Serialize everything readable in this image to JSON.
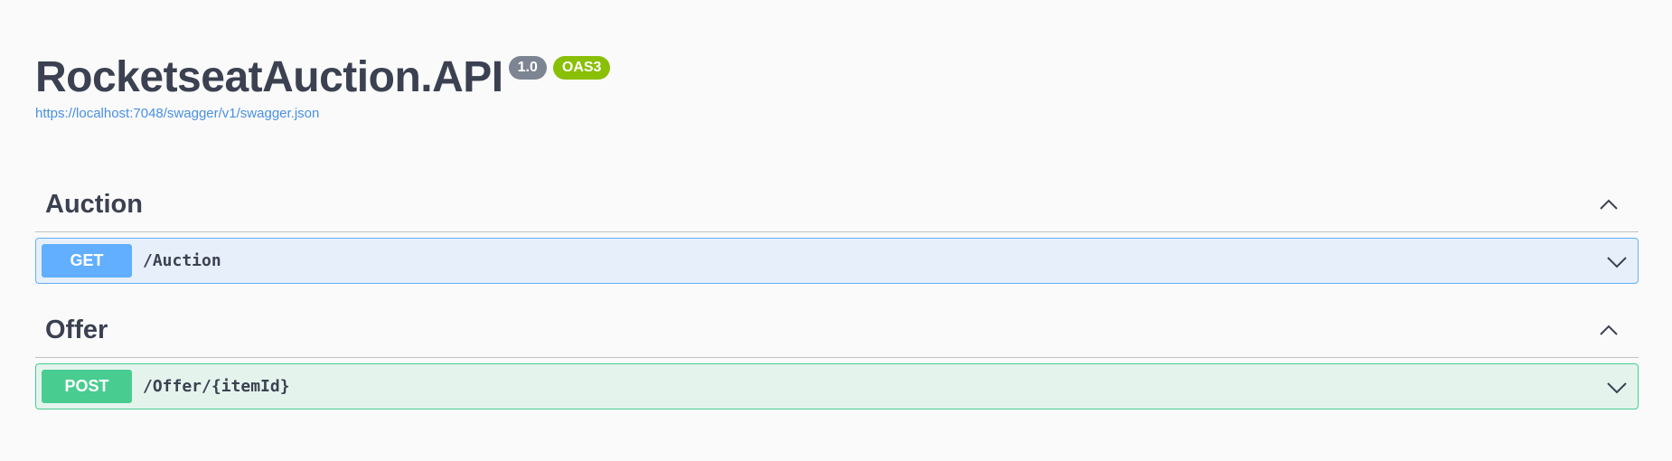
{
  "info": {
    "title": "RocketseatAuction.API",
    "version_badge": "1.0",
    "oas_badge": "OAS3",
    "spec_link": "https://localhost:7048/swagger/v1/swagger.json"
  },
  "tags": [
    {
      "name": "Auction",
      "operations": [
        {
          "method": "GET",
          "path": "/Auction"
        }
      ]
    },
    {
      "name": "Offer",
      "operations": [
        {
          "method": "POST",
          "path": "/Offer/{itemId}"
        }
      ]
    }
  ],
  "colors": {
    "get": "#61affe",
    "post": "#49cc90",
    "text": "#3b4151",
    "link": "#4990e2",
    "version_badge": "#7d8492",
    "oas_badge": "#89bf04"
  },
  "icons": {
    "tag_toggle": "chevron-up-icon",
    "op_toggle": "chevron-down-icon"
  }
}
